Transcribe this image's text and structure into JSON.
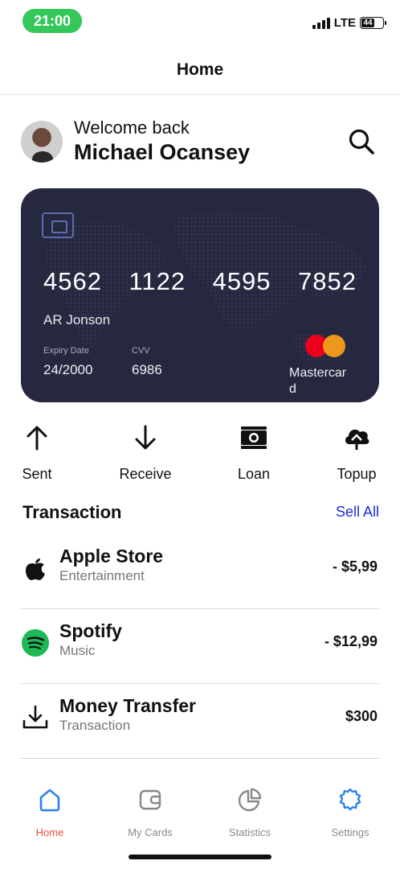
{
  "status_bar": {
    "time": "21:00",
    "network": "LTE",
    "battery_level": "44",
    "battery_fraction": 0.44
  },
  "nav": {
    "title": "Home"
  },
  "welcome": {
    "greeting": "Welcome back",
    "name": "Michael Ocansey",
    "search_icon": "search-icon"
  },
  "card": {
    "number_groups": [
      "4562",
      "1122",
      "4595",
      "7852"
    ],
    "holder": "AR Jonson",
    "expiry_label": "Expiry Date",
    "expiry_value": "24/2000",
    "cvv_label": "CVV",
    "cvv_value": "6986",
    "brand": "Mastercard",
    "brand_colors": {
      "red": "#eb001b",
      "orange": "#f79e1b"
    },
    "background": "#262840"
  },
  "actions": [
    {
      "label": "Sent",
      "icon": "arrow-up-icon"
    },
    {
      "label": "Receive",
      "icon": "arrow-down-icon"
    },
    {
      "label": "Loan",
      "icon": "money-stack-icon"
    },
    {
      "label": "Topup",
      "icon": "cloud-upload-icon"
    }
  ],
  "transactions": {
    "title": "Transaction",
    "see_all": "Sell All",
    "items": [
      {
        "name": "Apple Store",
        "category": "Entertainment",
        "amount": "- $5,99",
        "icon": "apple-icon"
      },
      {
        "name": "Spotify",
        "category": "Music",
        "amount": "- $12,99",
        "icon": "spotify-icon"
      },
      {
        "name": "Money Transfer",
        "category": "Transaction",
        "amount": "$300",
        "icon": "download-icon"
      }
    ]
  },
  "tabs": [
    {
      "label": "Home",
      "icon": "home-icon",
      "active": true
    },
    {
      "label": "My Cards",
      "icon": "wallet-icon",
      "active": false
    },
    {
      "label": "Statistics",
      "icon": "pie-chart-icon",
      "active": false
    },
    {
      "label": "Settings",
      "icon": "settings-icon",
      "active": false
    }
  ],
  "colors": {
    "accent_blue": "#1a2fd8",
    "active_tab": "#e8503a",
    "status_green": "#34c759",
    "tab_icon_blue": "#2f80ed"
  }
}
